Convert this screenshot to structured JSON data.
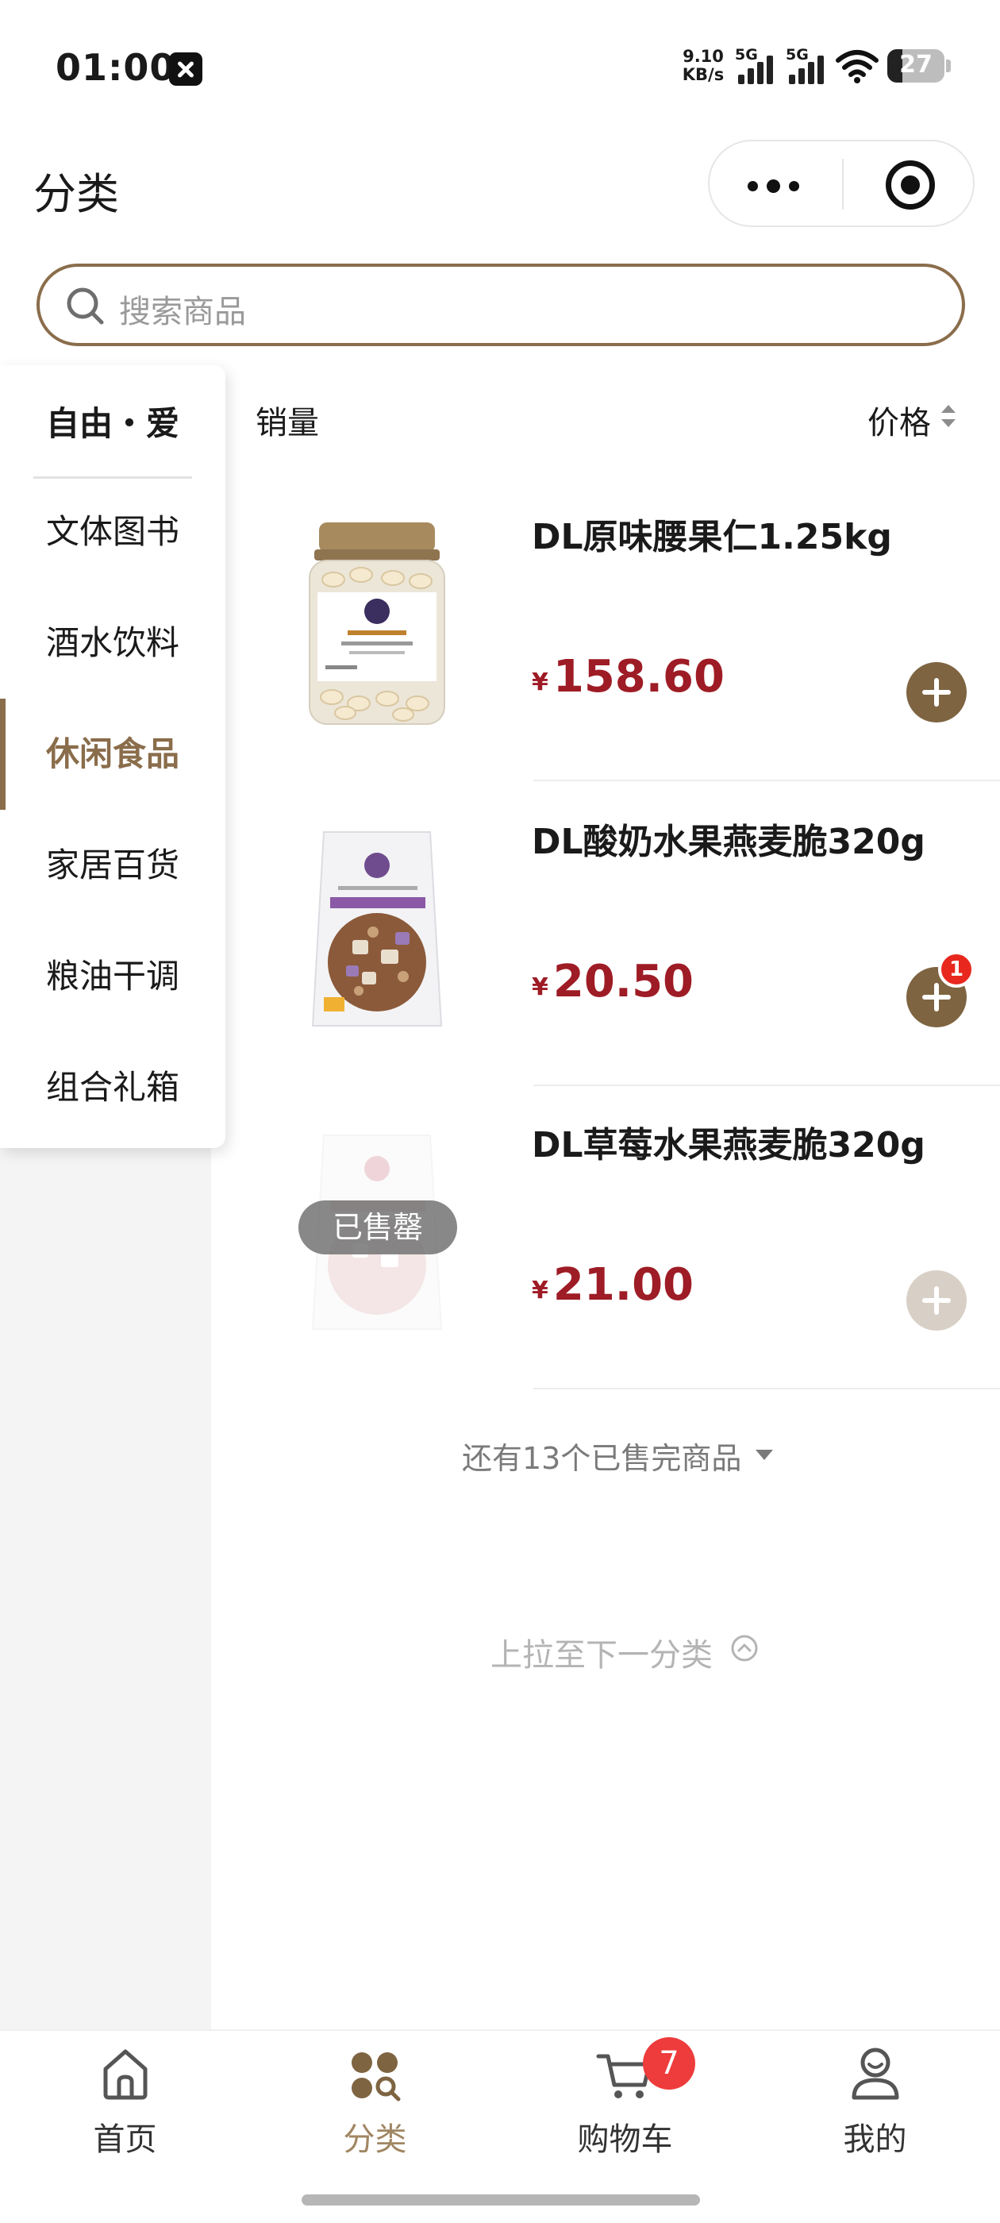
{
  "status_bar": {
    "time": "01:00",
    "net_speed_value": "9.10",
    "net_speed_unit": "KB/s",
    "signal_1": "5G",
    "signal_2": "5G",
    "battery": "27"
  },
  "header": {
    "title": "分类"
  },
  "search": {
    "placeholder": "搜索商品"
  },
  "sidebar": {
    "brand": "自由・爱",
    "items": [
      {
        "label": "文体图书"
      },
      {
        "label": "酒水饮料"
      },
      {
        "label": "休闲食品"
      },
      {
        "label": "家居百货"
      },
      {
        "label": "粮油干调"
      },
      {
        "label": "组合礼箱"
      }
    ],
    "active_index": 2
  },
  "sort": {
    "sales_label": "销量",
    "price_label": "价格"
  },
  "products": [
    {
      "name": "DL原味腰果仁1.25kg",
      "currency": "¥",
      "price": "158.60",
      "cart_qty": null,
      "sold_out": false
    },
    {
      "name": "DL酸奶水果燕麦脆320g",
      "currency": "¥",
      "price": "20.50",
      "cart_qty": "1",
      "sold_out": false
    },
    {
      "name": "DL草莓水果燕麦脆320g",
      "currency": "¥",
      "price": "21.00",
      "cart_qty": null,
      "sold_out": true,
      "sold_out_label": "已售罄"
    }
  ],
  "more_sold_out": "还有13个已售完商品",
  "pull_next": "上拉至下一分类",
  "tabbar": {
    "tabs": [
      {
        "label": "首页",
        "icon": "home-icon"
      },
      {
        "label": "分类",
        "icon": "category-icon"
      },
      {
        "label": "购物车",
        "icon": "cart-icon"
      },
      {
        "label": "我的",
        "icon": "profile-icon"
      }
    ],
    "active_index": 1,
    "cart_badge": "7"
  },
  "colors": {
    "accent": "#8a6d4b",
    "price": "#9e1c25",
    "badge": "#ee3b3b"
  }
}
